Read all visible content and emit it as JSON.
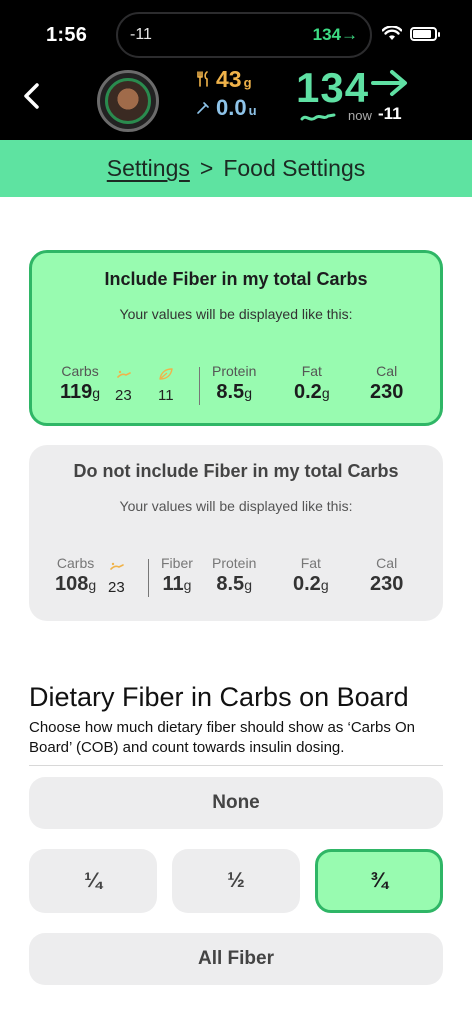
{
  "status_bar": {
    "time": "1:56",
    "island_delta": "-11",
    "island_glucose": "134→"
  },
  "header": {
    "carbs_value": "43",
    "carbs_unit": "g",
    "insulin_value": "0.0",
    "insulin_unit": "u",
    "glucose_value": "134",
    "now_label": "now",
    "delta": "-11"
  },
  "breadcrumb": {
    "parent": "Settings",
    "separator": ">",
    "current": "Food Settings"
  },
  "include_fiber_card": {
    "title": "Include Fiber in my total Carbs",
    "subtitle": "Your values will be displayed like this:",
    "carbs_label": "Carbs",
    "carbs_value": "119",
    "carbs_unit": "g",
    "sugar_value": "23",
    "fiber_value": "11",
    "protein_label": "Protein",
    "protein_value": "8.5",
    "protein_unit": "g",
    "fat_label": "Fat",
    "fat_value": "0.2",
    "fat_unit": "g",
    "cal_label": "Cal",
    "cal_value": "230"
  },
  "exclude_fiber_card": {
    "title": "Do not include Fiber in my total Carbs",
    "subtitle": "Your values will be displayed like this:",
    "carbs_label": "Carbs",
    "carbs_value": "108",
    "carbs_unit": "g",
    "sugar_value": "23",
    "fiber_label": "Fiber",
    "fiber_value": "11",
    "fiber_unit": "g",
    "protein_label": "Protein",
    "protein_value": "8.5",
    "protein_unit": "g",
    "fat_label": "Fat",
    "fat_value": "0.2",
    "fat_unit": "g",
    "cal_label": "Cal",
    "cal_value": "230"
  },
  "cob_section": {
    "title": "Dietary Fiber in Carbs on Board",
    "description": "Choose how much dietary fiber should show as ‘Carbs On Board’ (COB) and count towards insulin dosing.",
    "options": {
      "none": "None",
      "quarter": "¼",
      "half": "½",
      "three_quarters": "¾",
      "all": "All Fiber"
    },
    "selected": "¾"
  },
  "colors": {
    "accent_green": "#5ee3a1",
    "selected_fill": "#98fbb0",
    "selected_border": "#2fb666",
    "carbs_orange": "#f0b34a",
    "glucose_green": "#5fe0a3"
  },
  "icons": [
    "back-chevron-icon",
    "wifi-icon",
    "battery-icon",
    "fork-knife-icon",
    "syringe-icon",
    "right-arrow-icon",
    "sugar-icon",
    "fiber-leaf-icon"
  ]
}
